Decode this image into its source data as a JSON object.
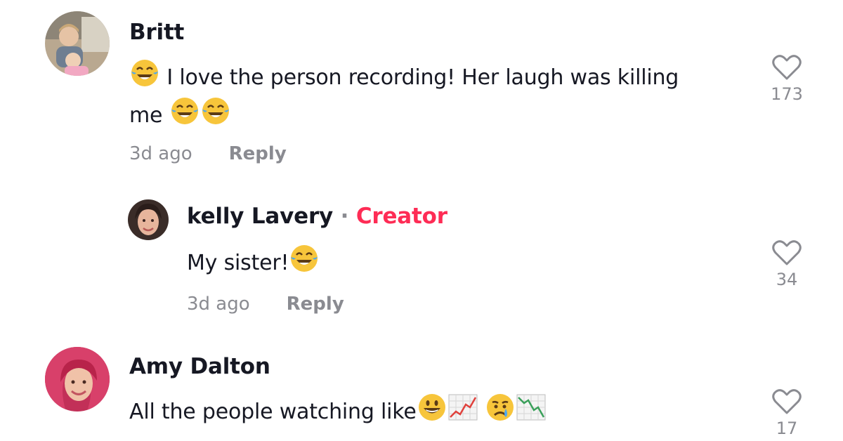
{
  "comments": [
    {
      "author": "Britt",
      "text_lines": [
        "I love the person recording! Her laugh was killing",
        "me"
      ],
      "time": "3d ago",
      "reply_label": "Reply",
      "likes": "173"
    },
    {
      "author": "kelly Lavery",
      "separator": "·",
      "badge": "Creator",
      "text": "My sister!",
      "time": "3d ago",
      "reply_label": "Reply",
      "likes": "34"
    },
    {
      "author": "Amy Dalton",
      "text": "All the people watching like",
      "likes": "17"
    }
  ],
  "colors": {
    "creator_badge": "#fe2c55",
    "meta_gray": "#8a8b91",
    "text": "#161823"
  },
  "icons": [
    "heart-outline-icon",
    "laughing-tears-emoji",
    "grinning-face-emoji",
    "chart-increasing-emoji",
    "crying-face-emoji",
    "chart-decreasing-emoji"
  ]
}
